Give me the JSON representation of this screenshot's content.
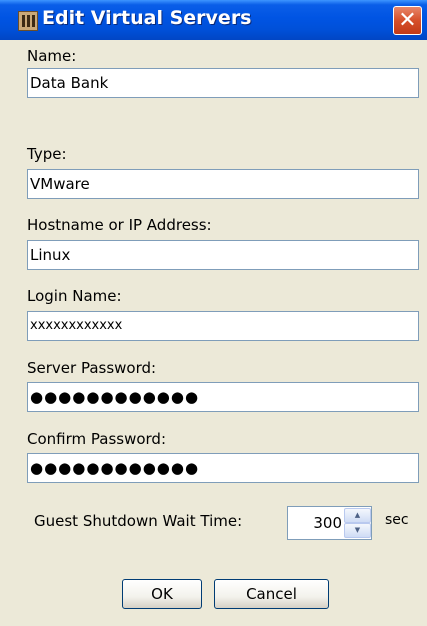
{
  "window": {
    "title": "Edit Virtual Servers",
    "close_glyph": "✕"
  },
  "fields": {
    "name": {
      "label": "Name:",
      "value": "Data Bank"
    },
    "type": {
      "label": "Type:",
      "value": "VMware"
    },
    "host": {
      "label": "Hostname or IP Address:",
      "value": "Linux"
    },
    "login": {
      "label": "Login Name:",
      "value": "xxxxxxxxxxxx"
    },
    "password": {
      "label": "Server Password:",
      "value": "●●●●●●●●●●●●"
    },
    "confirm": {
      "label": "Confirm Password:",
      "value": "●●●●●●●●●●●●"
    }
  },
  "wait_time": {
    "label": "Guest Shutdown Wait Time:",
    "value": "300",
    "unit": "sec"
  },
  "buttons": {
    "ok": "OK",
    "cancel": "Cancel"
  },
  "icons": {
    "app": "server-app-icon",
    "close": "close-icon",
    "spin_up": "spin-up-icon",
    "spin_down": "spin-down-icon"
  },
  "colors": {
    "titlebar": "#0054e3",
    "background": "#ece9d8",
    "close": "#d64f2a",
    "input_border": "#7f9db9"
  }
}
